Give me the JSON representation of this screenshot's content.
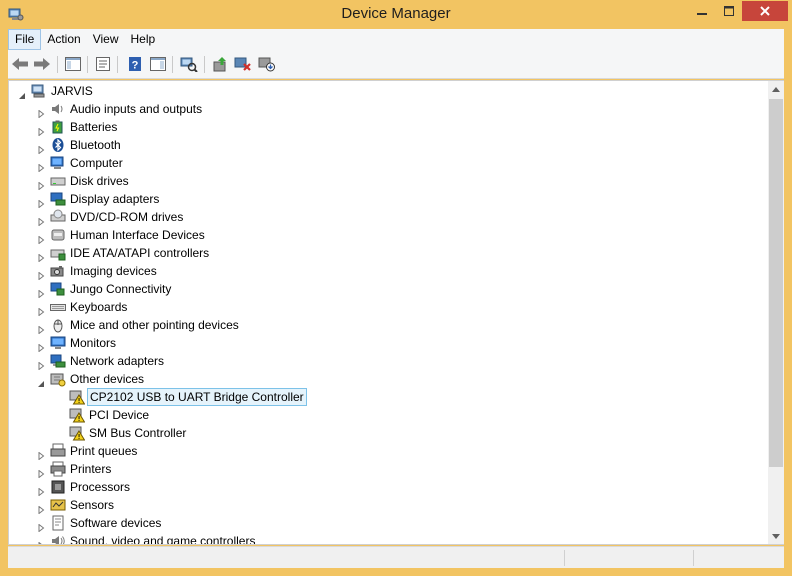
{
  "window": {
    "title": "Device Manager"
  },
  "menu": [
    "File",
    "Action",
    "View",
    "Help"
  ],
  "toolbar": {
    "buttons": [
      "back-icon",
      "forward-icon",
      "show-hide-console-tree-icon",
      "properties-icon",
      "help-icon",
      "action-pane-icon",
      "scan-hardware-icon",
      "update-driver-icon",
      "uninstall-icon",
      "disable-device-icon"
    ]
  },
  "tree": {
    "root": "JARVIS",
    "categories": [
      {
        "label": "Audio inputs and outputs",
        "icon": "speaker-icon"
      },
      {
        "label": "Batteries",
        "icon": "battery-icon"
      },
      {
        "label": "Bluetooth",
        "icon": "bluetooth-icon"
      },
      {
        "label": "Computer",
        "icon": "computer-icon"
      },
      {
        "label": "Disk drives",
        "icon": "disk-drive-icon"
      },
      {
        "label": "Display adapters",
        "icon": "display-adapter-icon"
      },
      {
        "label": "DVD/CD-ROM drives",
        "icon": "dvd-icon"
      },
      {
        "label": "Human Interface Devices",
        "icon": "hid-icon"
      },
      {
        "label": "IDE ATA/ATAPI controllers",
        "icon": "ide-icon"
      },
      {
        "label": "Imaging devices",
        "icon": "camera-icon"
      },
      {
        "label": "Jungo Connectivity",
        "icon": "jungo-icon"
      },
      {
        "label": "Keyboards",
        "icon": "keyboard-icon"
      },
      {
        "label": "Mice and other pointing devices",
        "icon": "mouse-icon"
      },
      {
        "label": "Monitors",
        "icon": "monitor-icon"
      },
      {
        "label": "Network adapters",
        "icon": "network-icon"
      },
      {
        "label": "Other devices",
        "icon": "other-devices-icon",
        "expanded": true
      },
      {
        "label": "Print queues",
        "icon": "print-queue-icon"
      },
      {
        "label": "Printers",
        "icon": "printer-icon"
      },
      {
        "label": "Processors",
        "icon": "processor-icon"
      },
      {
        "label": "Sensors",
        "icon": "sensor-icon"
      },
      {
        "label": "Software devices",
        "icon": "software-device-icon"
      },
      {
        "label": "Sound, video and game controllers",
        "icon": "sound-icon"
      }
    ],
    "other_devices_children": [
      {
        "label": "CP2102 USB to UART Bridge Controller",
        "icon": "warning-device-icon",
        "selected": true
      },
      {
        "label": "PCI Device",
        "icon": "warning-device-icon"
      },
      {
        "label": "SM Bus Controller",
        "icon": "warning-device-icon"
      }
    ]
  },
  "colors": {
    "title_bar": "#f2c462",
    "close_button": "#c7453b",
    "selection_border": "#7dc2e8",
    "selection_fill": "#e5f3fb"
  }
}
